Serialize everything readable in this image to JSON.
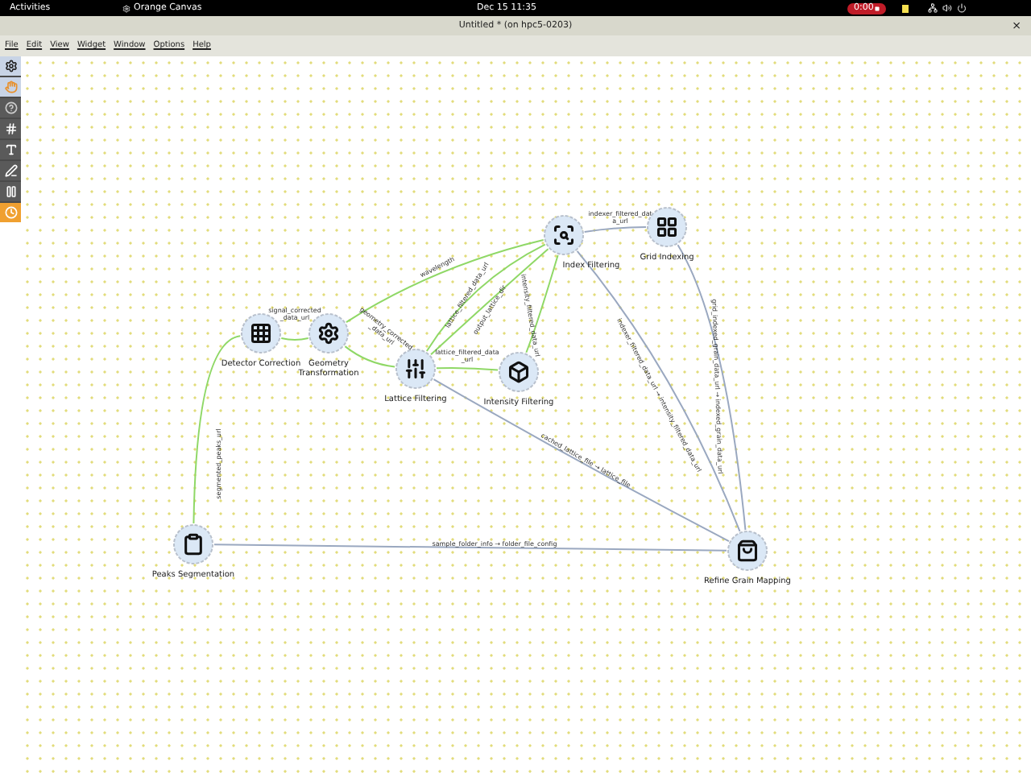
{
  "top_bar": {
    "activities": "Activities",
    "app": "Orange Canvas",
    "clock": "Dec 15  11:35",
    "recording": "0:00"
  },
  "window": {
    "title": "Untitled * (on hpc5-0203)",
    "close": "×"
  },
  "menu": [
    "File",
    "Edit",
    "View",
    "Widget",
    "Window",
    "Options",
    "Help"
  ],
  "nodes": [
    {
      "label_lines": [
        "Detector Correction"
      ]
    },
    {
      "label_lines": [
        "Geometry",
        "Transformation"
      ]
    },
    {
      "label_lines": [
        "Lattice Filtering"
      ]
    },
    {
      "label_lines": [
        "Intensity Filtering"
      ]
    },
    {
      "label_lines": [
        "Index Filtering"
      ]
    },
    {
      "label_lines": [
        "Grid Indexing"
      ]
    },
    {
      "label_lines": [
        "Peaks Segmentation"
      ]
    },
    {
      "label_lines": [
        "Refine Grain Mapping"
      ]
    }
  ],
  "links": [
    {
      "active": true,
      "label_lines": [
        "signal_corrected",
        "_data_url"
      ]
    },
    {
      "active": true,
      "label_lines": [
        "wavelength"
      ]
    },
    {
      "active": true,
      "label_lines": [
        "geometry_corrected",
        "_data_url"
      ]
    },
    {
      "active": true,
      "label_lines": [
        "lattice_filtered_data_url"
      ]
    },
    {
      "active": true,
      "label_lines": [
        "output_lattice_dir"
      ]
    },
    {
      "active": true,
      "label_lines": [
        "lattice_filtered_data",
        "_url"
      ]
    },
    {
      "active": true,
      "label_lines": [
        "intensity_filtered_data_url"
      ]
    },
    {
      "active": false,
      "label_lines": [
        "indexer_filtered_dat",
        "a_url"
      ]
    },
    {
      "active": false,
      "label_lines": [
        "indexer_filtered_data_url → intensity_filtered_data_url"
      ]
    },
    {
      "active": false,
      "label_lines": [
        "grid_indexed_grain_data_url → indexed_grain_data_url"
      ]
    },
    {
      "active": false,
      "label_lines": [
        "cached_lattice_file → lattice_file"
      ]
    },
    {
      "active": false,
      "label_lines": [
        "sample_folder_info → folder_file_config"
      ]
    },
    {
      "active": true,
      "label_lines": [
        "segmented_peaks_url"
      ]
    }
  ]
}
